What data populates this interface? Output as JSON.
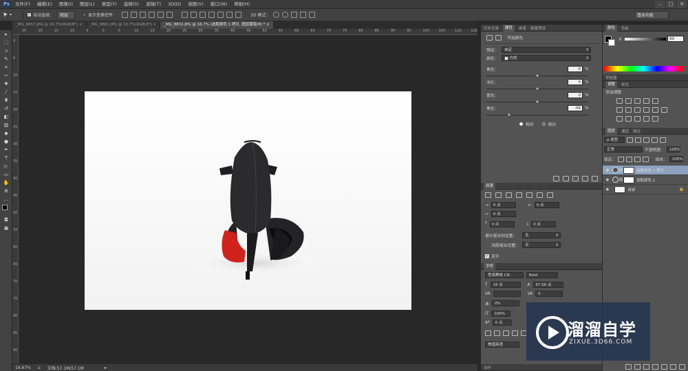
{
  "app": {
    "logo": "Ps"
  },
  "menubar": {
    "items": [
      "文件(F)",
      "编辑(E)",
      "图像(I)",
      "图层(L)",
      "类型(Y)",
      "选择(S)",
      "滤镜(T)",
      "3D(D)",
      "视图(V)",
      "窗口(W)",
      "帮助(H)"
    ],
    "window_controls": [
      "–",
      "□",
      "✕"
    ]
  },
  "options_bar": {
    "auto_select_label": "自动选择：",
    "auto_select_value": "图层",
    "show_transform_label": "显示变换控件",
    "mode_3d_label": "3D 模式：",
    "workspace": "基本功能"
  },
  "tabs": [
    {
      "label": "_MG_8857.JPG @ 16.7%(RGB/8*)",
      "close": "×"
    },
    {
      "label": "_MG_8861.JPG @ 16.7%(RGB/8*)",
      "close": "×"
    },
    {
      "label": "_MG_8831.JPG @ 16.7% (选取颜色 1 拷贝, 图层蒙版/8) *",
      "close": "×"
    }
  ],
  "rulers": {
    "top": [
      "25",
      "20",
      "15",
      "10",
      "5",
      "0",
      "5",
      "10",
      "15",
      "20",
      "25",
      "30",
      "35",
      "40",
      "45",
      "50",
      "55",
      "60",
      "65",
      "70",
      "75",
      "80",
      "85",
      "90",
      "95",
      "100",
      "105",
      "110",
      "115"
    ],
    "left": [
      "0",
      "5",
      "10",
      "15",
      "20",
      "25",
      "30",
      "35",
      "40",
      "45",
      "50",
      "55",
      "60",
      "65",
      "70",
      "75",
      "80",
      "85",
      "90"
    ]
  },
  "status": {
    "zoom": "16.67%",
    "doc": "文档:57.1M/57.1M"
  },
  "properties": {
    "tabs": [
      "历史记录",
      "属性",
      "画笔",
      "画笔预设"
    ],
    "active_tab": "属性",
    "title": "可选颜色",
    "preset_label": "预设：",
    "preset_value": "自定",
    "color_label": "颜色：",
    "color_value": "白色",
    "sliders": [
      {
        "label": "青色：",
        "value": "0",
        "unit": "%",
        "level": 0
      },
      {
        "label": "洋红：",
        "value": "0",
        "unit": "%",
        "level": 0
      },
      {
        "label": "黄色：",
        "value": "0",
        "unit": "%",
        "level": 0
      },
      {
        "label": "黑色：",
        "value": "-56",
        "unit": "%",
        "level": -56
      }
    ],
    "relative_label": "相对",
    "absolute_label": "绝对"
  },
  "paragraph": {
    "title": "段落",
    "indent_left": "0 点",
    "indent_right": "0 点",
    "indent_first": "0 点",
    "space_before": "0 点",
    "space_after": "0 点",
    "kinsoku_label": "避头尾法则设置：",
    "kinsoku_value": "无",
    "mojikumi_label": "间距组合设置：",
    "mojikumi_value": "无",
    "hyphenate_label": "连字"
  },
  "character": {
    "title": "字符",
    "font_family": "思源黑体 CN",
    "font_style": "Bold",
    "font_size": "16 点",
    "leading": "67.56 点",
    "kerning": "",
    "tracking": "0",
    "scale_label": "0%",
    "vertical_scale": "100%",
    "baseline": "0 点",
    "language": "美国英语",
    "bottom_tab": "动作"
  },
  "color_panel": {
    "tabs": [
      "颜色",
      "色板"
    ],
    "channel": "K",
    "value": "99"
  },
  "navigator": {
    "tab": "导航器"
  },
  "adjustments": {
    "tabs": [
      "调整",
      "样式"
    ],
    "title": "添加调整"
  },
  "layers": {
    "tabs": [
      "图层",
      "通道",
      "路径"
    ],
    "kind": "ρ 类型",
    "blend_mode": "正常",
    "opacity_label": "不透明度：",
    "opacity": "100%",
    "lock_label": "锁定：",
    "fill_label": "填充：",
    "fill": "100%",
    "items": [
      {
        "name": "选取颜色 1 拷贝",
        "selected": true
      },
      {
        "name": "选取颜色 1",
        "selected": false
      },
      {
        "name": "背景",
        "selected": false
      }
    ]
  },
  "watermark": {
    "brand": "溜溜自学",
    "url": "ZIXUE.3D66.COM"
  },
  "colors": {
    "accent": "#8da2bf",
    "panel": "#535353",
    "sole": "#d0221d",
    "shoe": "#2b2b2d"
  }
}
